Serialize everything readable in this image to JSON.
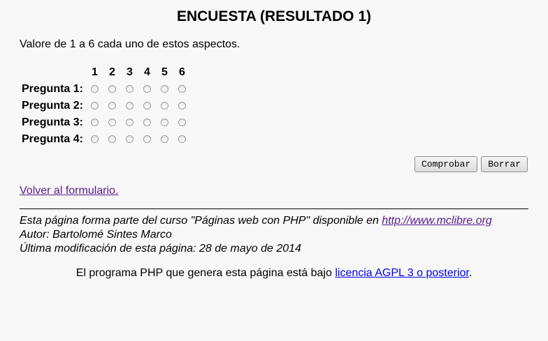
{
  "page": {
    "title": "ENCUESTA (RESULTADO 1)",
    "intro": "Valore de 1 a 6 cada uno de estos aspectos."
  },
  "survey": {
    "scale": [
      "1",
      "2",
      "3",
      "4",
      "5",
      "6"
    ],
    "questions": [
      "Pregunta 1:",
      "Pregunta 2:",
      "Pregunta 3:",
      "Pregunta 4:"
    ]
  },
  "buttons": {
    "check": "Comprobar",
    "clear": "Borrar"
  },
  "back_link": "Volver al formulario.",
  "footer": {
    "line1_prefix": "Esta página forma parte del curso \"Páginas web con PHP\" disponible en ",
    "line1_link": "http://www.mclibre.org",
    "author": "Autor: Bartolomé Sintes Marco",
    "modified": "Última modificación de esta página: 28 de mayo de 2014"
  },
  "license": {
    "prefix": "El programa PHP que genera esta página está bajo ",
    "link": "licencia AGPL 3 o posterior",
    "suffix": "."
  }
}
